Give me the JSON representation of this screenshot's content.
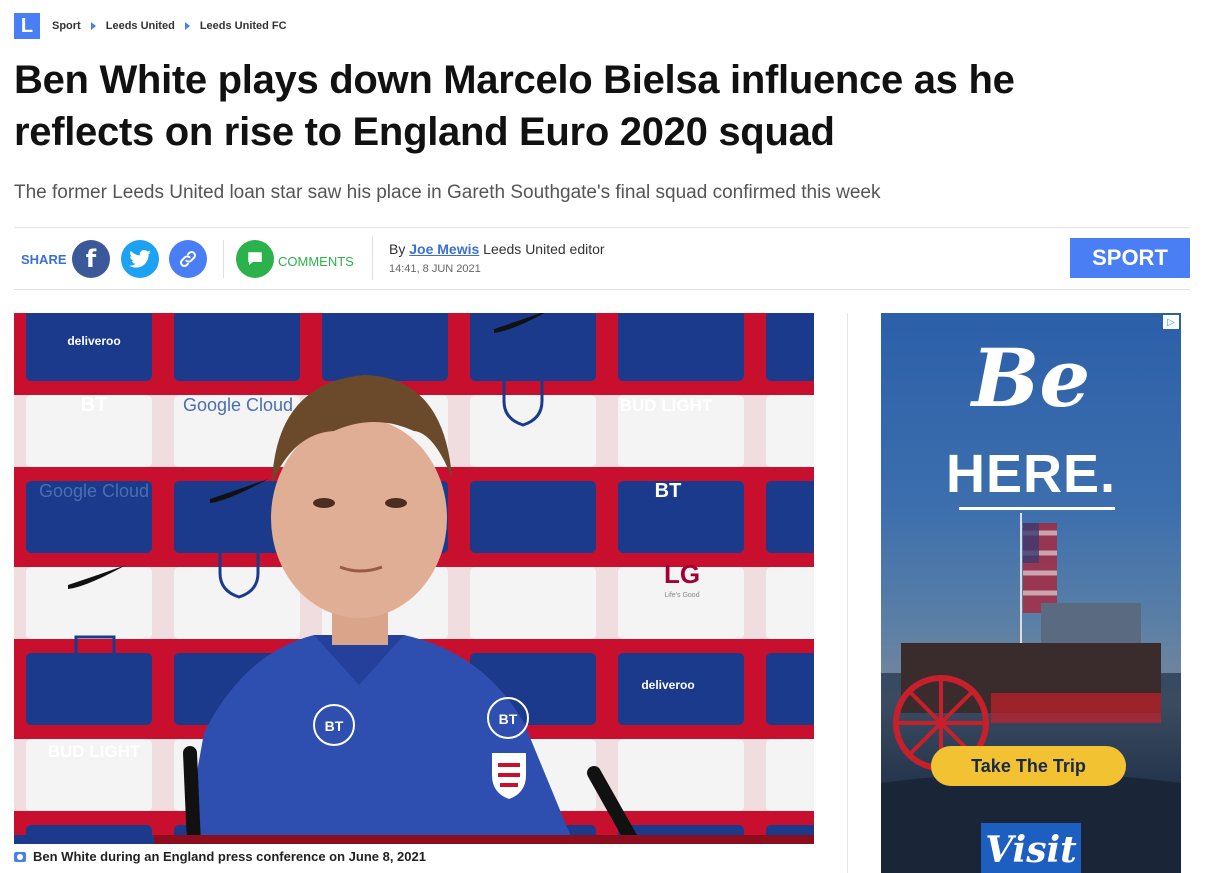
{
  "breadcrumb": {
    "logo_letter": "L",
    "items": [
      "Sport",
      "Leeds United",
      "Leeds United FC"
    ]
  },
  "article": {
    "headline": "Ben White plays down Marcelo Bielsa influence as he reflects on rise to England Euro 2020 squad",
    "standfirst": "The former Leeds United loan star saw his place in Gareth Southgate's final squad confirmed this week",
    "byline_prefix": "By",
    "author": "Joe Mewis",
    "author_role": "Leeds United editor",
    "timestamp": "14:41, 8 JUN 2021",
    "section_tag": "SPORT"
  },
  "share": {
    "label": "SHARE",
    "comments_label": "COMMENTS",
    "buttons": [
      {
        "icon": "facebook-icon"
      },
      {
        "icon": "twitter-icon"
      },
      {
        "icon": "link-icon"
      },
      {
        "icon": "comment-icon"
      }
    ]
  },
  "photo": {
    "caption": "Ben White during an England press conference on June 8, 2021",
    "backdrop_logos": [
      "deliveroo",
      "BT",
      "Google Cloud",
      "BUD LIGHT",
      "LG",
      "Life's Good"
    ]
  },
  "ad": {
    "headline_line1": "Be",
    "headline_line2": "HERE.",
    "cta": "Take The Trip",
    "brand": "Visit",
    "choices": "▷"
  },
  "colors": {
    "accent": "#4a7ef5",
    "facebook": "#3b5998",
    "twitter": "#1da1f2",
    "comments": "#2bb24c",
    "backdrop_red": "#c8102e",
    "backdrop_blue": "#1b3a8c",
    "ad_button": "#f2c233"
  }
}
